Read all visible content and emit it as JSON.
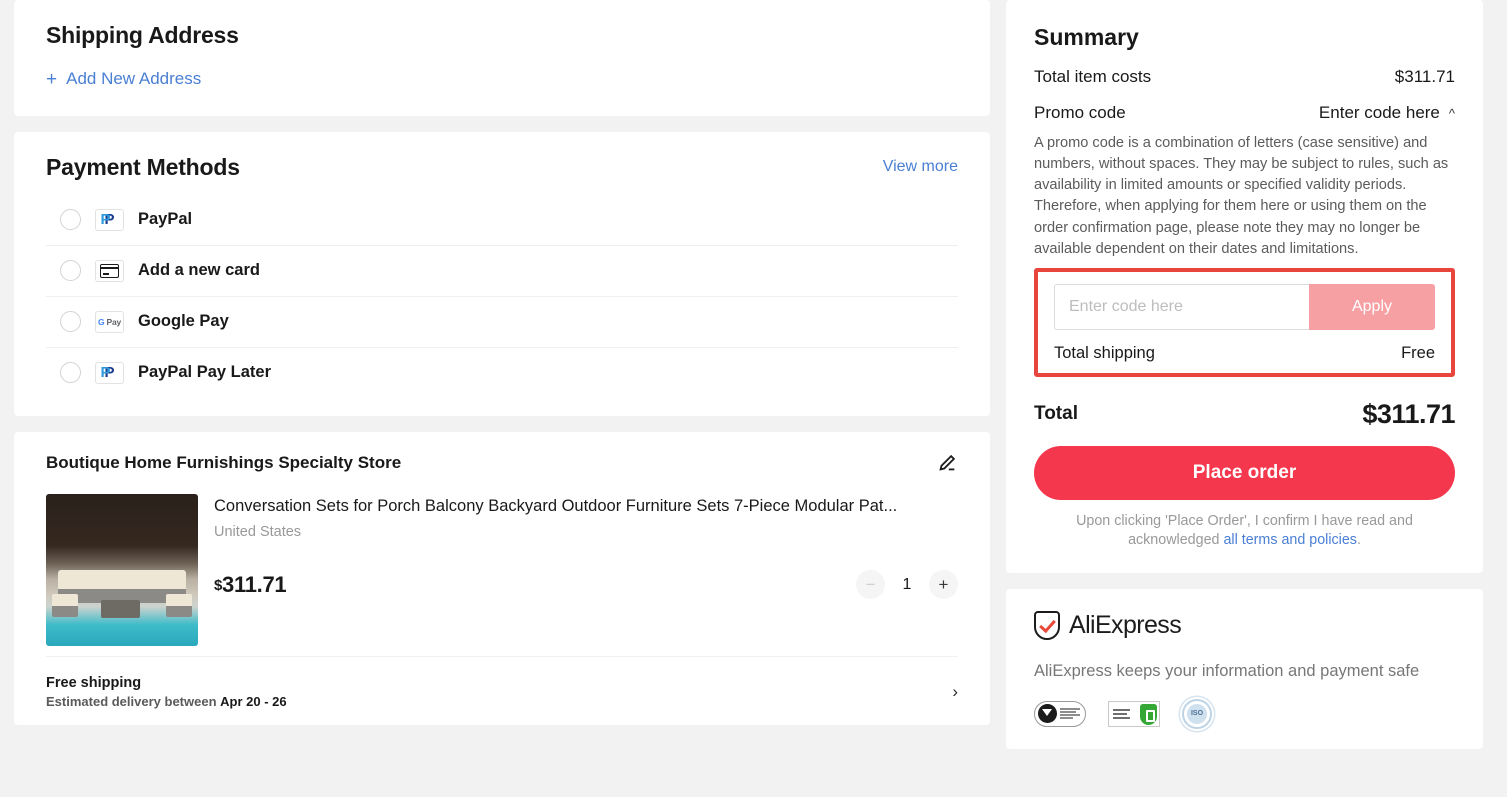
{
  "shipping": {
    "title": "Shipping Address",
    "add_new_label": "Add New Address",
    "plus_icon": "plus-icon"
  },
  "payment": {
    "title": "Payment Methods",
    "view_more_label": "View more",
    "methods": [
      {
        "label": "PayPal",
        "icon": "paypal-icon"
      },
      {
        "label": "Add a new card",
        "icon": "credit-card-icon"
      },
      {
        "label": "Google Pay",
        "icon": "google-pay-icon"
      },
      {
        "label": "PayPal Pay Later",
        "icon": "paypal-icon"
      }
    ]
  },
  "product": {
    "store_name": "Boutique Home Furnishings Specialty Store",
    "edit_icon": "pencil-icon",
    "title": "Conversation Sets for Porch Balcony Backyard Outdoor Furniture Sets 7-Piece Modular Pat...",
    "ship_from": "United States",
    "currency": "$",
    "price": "311.71",
    "qty": "1",
    "minus_label": "−",
    "plus_label": "+",
    "shipping_label": "Free shipping",
    "eta_prefix": "Estimated delivery between",
    "eta_dates": "Apr 20 - 26",
    "chevron_icon": "chevron-right-icon"
  },
  "summary": {
    "title": "Summary",
    "item_costs_label": "Total item costs",
    "item_costs_value": "$311.71",
    "promo_label": "Promo code",
    "promo_toggle_label": "Enter code here",
    "promo_toggle_icon": "chevron-up-icon",
    "promo_description": "A promo code is a combination of letters (case sensitive) and numbers, without spaces. They may be subject to rules, such as availability in limited amounts or specified validity periods. Therefore, when applying for them here or using them on the order confirmation page, please note they may no longer be available dependent on their dates and limitations.",
    "promo_placeholder": "Enter code here",
    "promo_value": "",
    "apply_label": "Apply",
    "total_shipping_label": "Total shipping",
    "total_shipping_value": "Free",
    "total_label": "Total",
    "total_value": "$311.71",
    "place_order_label": "Place order",
    "terms_prefix": "Upon clicking 'Place Order', I confirm I have read and acknowledged ",
    "terms_link": "all terms and policies",
    "terms_suffix": ".",
    "highlight_color": "#e8453c",
    "accent_color": "#f4374c"
  },
  "footer": {
    "brand": "AliExpress",
    "brand_icon": "aliexpress-shield-icon",
    "tagline": "AliExpress keeps your information and payment safe",
    "badges": [
      "truste-seal-icon",
      "ssl-secure-icon",
      "iso-certified-icon"
    ],
    "iso_text": "ISO"
  }
}
